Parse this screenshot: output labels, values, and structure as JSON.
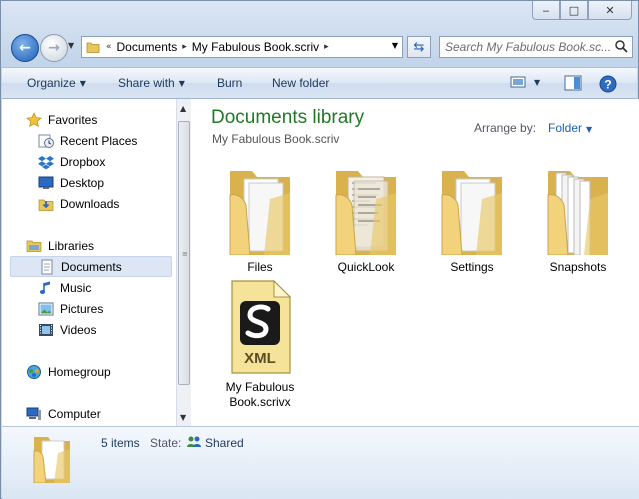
{
  "window": {
    "minimize": "‒",
    "maximize": "□",
    "close": "✕"
  },
  "address": {
    "overflow": "«",
    "crumbs": [
      "Documents",
      "My Fabulous Book.scriv"
    ]
  },
  "search": {
    "placeholder": "Search My Fabulous Book.sc..."
  },
  "toolbar": {
    "organize": "Organize",
    "share": "Share with",
    "burn": "Burn",
    "new_folder": "New folder"
  },
  "sidebar": {
    "favorites": "Favorites",
    "recent": "Recent Places",
    "dropbox": "Dropbox",
    "desktop": "Desktop",
    "downloads": "Downloads",
    "libraries": "Libraries",
    "documents": "Documents",
    "music": "Music",
    "pictures": "Pictures",
    "videos": "Videos",
    "homegroup": "Homegroup",
    "computer": "Computer"
  },
  "library": {
    "title": "Documents library",
    "subtitle": "My Fabulous Book.scriv",
    "arrange_label": "Arrange by:",
    "arrange_value": "Folder"
  },
  "items": [
    {
      "name": "Files"
    },
    {
      "name": "QuickLook"
    },
    {
      "name": "Settings"
    },
    {
      "name": "Snapshots"
    },
    {
      "name": "My Fabulous Book.scrivx",
      "badge": "XML"
    }
  ],
  "status": {
    "count": "5 items",
    "state_label": "State:",
    "state_value": "Shared"
  },
  "colors": {
    "title_green": "#1e7a25",
    "link_blue": "#1f5fb4",
    "folder": "#f2d27a"
  }
}
